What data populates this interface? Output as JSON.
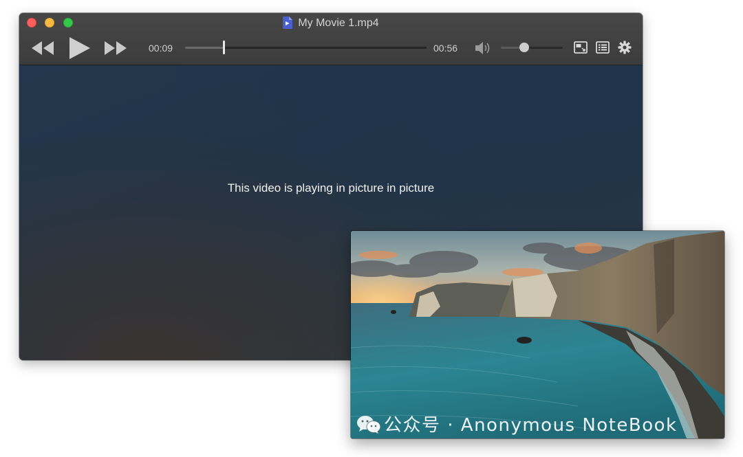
{
  "window": {
    "title": "My Movie 1.mp4",
    "file_icon": "video-file-icon"
  },
  "controls": {
    "current_time": "00:09",
    "total_time": "00:56",
    "seek_progress": 0.16,
    "volume_level": 0.38,
    "icons": {
      "rewind": "rewind-icon",
      "play": "play-icon",
      "forward": "fast-forward-icon",
      "volume": "volume-icon",
      "pip": "picture-in-picture-icon",
      "playlist": "playlist-icon",
      "settings": "gear-icon"
    }
  },
  "video": {
    "message": "This video is playing in picture in picture"
  },
  "pip": {
    "watermark": "公众号 · Anonymous NoteBook",
    "watermark_logo": "wechat-logo-icon"
  },
  "colors": {
    "close": "#fc605c",
    "minimize": "#fcbb40",
    "maximize": "#34c84a",
    "titlebar": "#424242",
    "file_icon": "#4a5fd1"
  }
}
